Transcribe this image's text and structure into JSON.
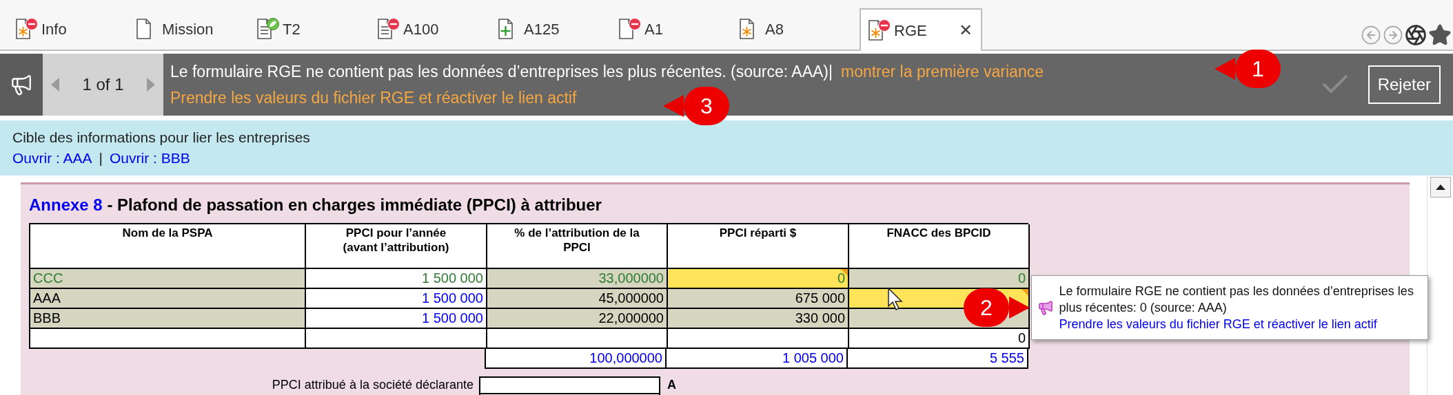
{
  "tabs": [
    {
      "label": "Info",
      "kind": "star",
      "error": true,
      "validated": false,
      "selected": false
    },
    {
      "label": "Mission",
      "kind": "blank",
      "error": false,
      "validated": false,
      "selected": false
    },
    {
      "label": "T2",
      "kind": "lines",
      "error": false,
      "validated": true,
      "selected": false
    },
    {
      "label": "A100",
      "kind": "lines",
      "error": true,
      "validated": false,
      "selected": false
    },
    {
      "label": "A125",
      "kind": "plus",
      "error": false,
      "validated": false,
      "selected": false
    },
    {
      "label": "A1",
      "kind": "blank",
      "error": true,
      "validated": false,
      "selected": false
    },
    {
      "label": "A8",
      "kind": "star",
      "error": false,
      "validated": false,
      "selected": false
    },
    {
      "label": "RGE",
      "kind": "star",
      "error": true,
      "validated": false,
      "selected": true,
      "close": "✕"
    }
  ],
  "notification": {
    "pager": "1 of 1",
    "message": "Le formulaire RGE ne contient pas les données d’entreprises les plus récentes. (source: AAA)|",
    "link_first": "montrer la première variance",
    "link_action": "Prendre les valeurs du fichier RGE et réactiver le lien actif",
    "dismiss": "Rejeter"
  },
  "info_band": {
    "title": "Cible des informations pour lier les entreprises",
    "links": [
      "Ouvrir : AAA",
      "Ouvrir : BBB"
    ],
    "separator": "|"
  },
  "form": {
    "title_link": "Annexe 8",
    "title": " - Plafond de passation en charges immédiate (PPCI) à attribuer",
    "columns": [
      "Nom de la PSPA",
      "PPCI pour l’année (avant l’attribution)",
      "% de l’attribution de la PPCI",
      "PPCI réparti $",
      "FNACC des BPCID"
    ],
    "rows": [
      [
        {
          "text": "CCC",
          "kind": "computed",
          "highlighted": false,
          "color": "#2e7d32"
        },
        {
          "text": "1 500 000",
          "kind": "input",
          "highlighted": false,
          "color": "#2e7d32"
        },
        {
          "text": "33,000000",
          "kind": "computed",
          "highlighted": false,
          "color": "#2e7d32"
        },
        {
          "text": "0",
          "highlighted": true,
          "color": "#2e7d32"
        },
        {
          "text": "0",
          "kind": "computed",
          "highlighted": false,
          "color": "#2e7d32"
        }
      ],
      [
        {
          "text": "AAA",
          "kind": "computed",
          "highlighted": false,
          "color": "#000000"
        },
        {
          "text": "1 500 000",
          "kind": "input",
          "highlighted": false,
          "color": "#0000ff"
        },
        {
          "text": "45,000000",
          "kind": "computed",
          "highlighted": false,
          "color": "#000000"
        },
        {
          "text": "675 000",
          "kind": "computed",
          "highlighted": false,
          "color": "#000000"
        },
        {
          "highlighted": true
        }
      ],
      [
        {
          "text": "BBB",
          "kind": "computed",
          "highlighted": false,
          "color": "#000000"
        },
        {
          "text": "1 500 000",
          "kind": "input",
          "highlighted": false,
          "color": "#0000ff"
        },
        {
          "text": "22,000000",
          "kind": "computed",
          "highlighted": false,
          "color": "#000000"
        },
        {
          "text": "330 000",
          "kind": "computed",
          "highlighted": false,
          "color": "#000000"
        },
        {
          "kind": "computed",
          "highlighted": false
        }
      ],
      [
        {
          "kind": "input",
          "highlighted": false
        },
        {
          "kind": "input",
          "highlighted": false
        },
        {
          "kind": "input",
          "highlighted": false
        },
        {
          "kind": "input",
          "highlighted": false
        },
        {
          "text": "0",
          "kind": "input",
          "highlighted": false,
          "color": "#000000"
        }
      ]
    ],
    "totals": [
      "100,000000",
      "1 005 000",
      "5 555"
    ],
    "allocated_label": "PPCI attribué à la société déclarante",
    "allocated_letter": "A"
  },
  "tooltip": {
    "message": "Le formulaire RGE ne contient pas les données d’entreprises les plus récentes: 0 (source: AAA)",
    "link": "Prendre les valeurs du fichier RGE et réactiver le lien actif"
  },
  "callouts": [
    "1",
    "2",
    "3"
  ]
}
